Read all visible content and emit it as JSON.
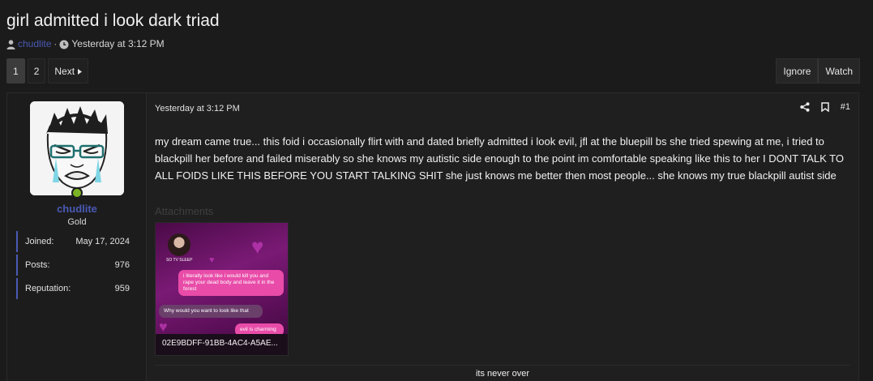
{
  "thread": {
    "title": "girl admitted i look dark triad",
    "author": "chudlite",
    "separator": "·",
    "date": "Yesterday at 3:12 PM"
  },
  "pagination": {
    "pages": [
      "1",
      "2"
    ],
    "current": "1",
    "next_label": "Next"
  },
  "actions": {
    "ignore_label": "Ignore",
    "watch_label": "Watch"
  },
  "post": {
    "user": {
      "name": "chudlite",
      "title": "Gold",
      "online": true,
      "stats": [
        {
          "label": "Joined:",
          "value": "May 17, 2024"
        },
        {
          "label": "Posts:",
          "value": "976"
        },
        {
          "label": "Reputation:",
          "value": "959"
        }
      ]
    },
    "date": "Yesterday at 3:12 PM",
    "number": "#1",
    "body": "my dream came true... this foid i occasionally flirt with and dated briefly admitted i look evil, jfl at the bluepill bs she tried spewing at me, i tried to blackpill her before and failed miserably so she knows my autistic side enough to the point im comfortable speaking like this to her I DONT TALK TO ALL FOIDS LIKE THIS BEFORE YOU START TALKING SHIT she just knows me better then most people... she knows my true blackpill autist side",
    "attachments_label": "Attachments",
    "attachment": {
      "filename": "02E9BDFF-91BB-4AC4-A5AE...",
      "contact_name": "SO TV SLEEP",
      "messages": [
        {
          "text": "i literally look like i would kill you and rape your dead body and leave it in the forest",
          "side": "right"
        },
        {
          "text": "Why would you want to look like that",
          "side": "left"
        },
        {
          "text": "evil is charming",
          "side": "right"
        }
      ]
    },
    "signature": "its never over"
  },
  "colors": {
    "link": "#4a5ab4",
    "online": "#7cb324",
    "background": "#1b1b1b"
  },
  "icons": [
    "user-icon",
    "clock-icon",
    "share-icon",
    "bookmark-icon",
    "chevron-right-icon"
  ]
}
